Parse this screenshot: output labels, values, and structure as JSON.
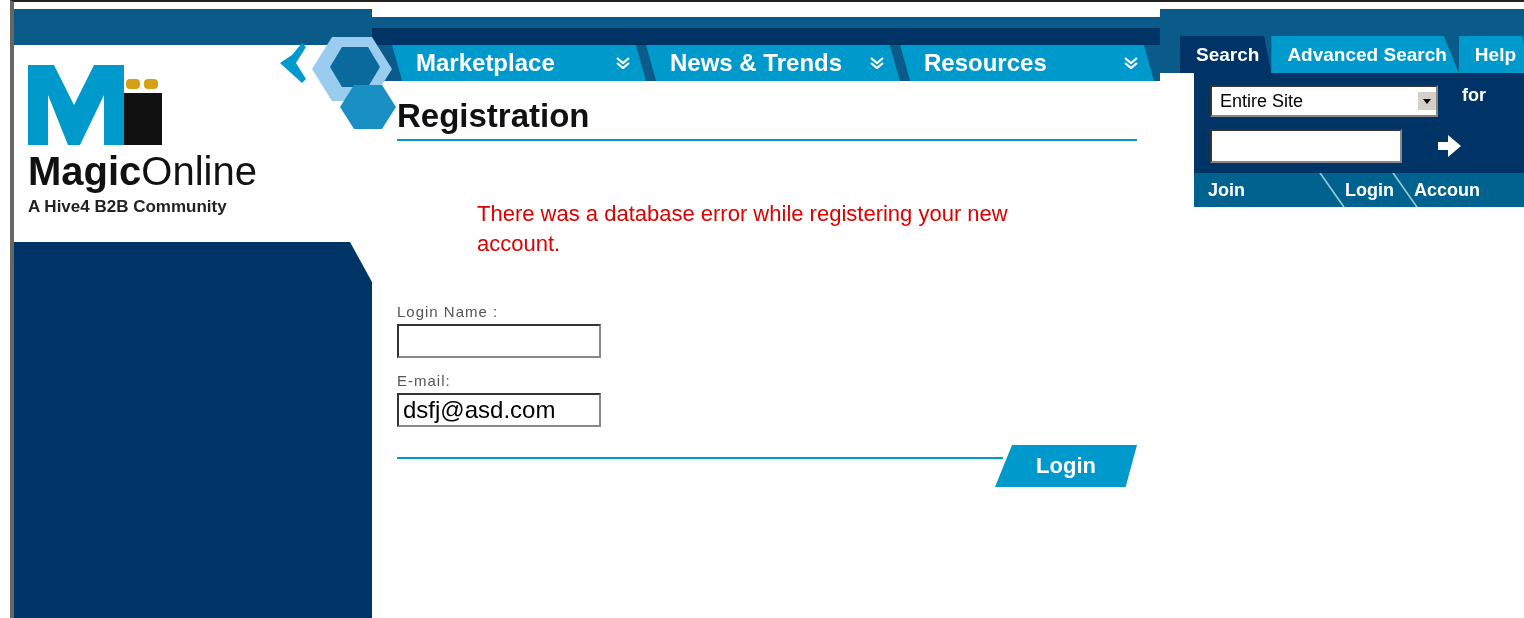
{
  "logo": {
    "name_bold": "Magic",
    "name_rest": "Online",
    "tagline": "A Hive4 B2B Community"
  },
  "nav": [
    {
      "label": "Marketplace"
    },
    {
      "label": "News & Trends"
    },
    {
      "label": "Resources"
    }
  ],
  "search_tabs": [
    {
      "label": "Search",
      "selected": true
    },
    {
      "label": "Advanced Search",
      "selected": false
    },
    {
      "label": "Help",
      "selected": false
    }
  ],
  "search": {
    "scope": "Entire Site",
    "for_label": "for"
  },
  "account_links": [
    "Join",
    "Login",
    "Accoun"
  ],
  "page_title": "Registration",
  "error": "There was a database error while registering your new account.",
  "fields": [
    {
      "label": "Login Name :"
    },
    {
      "label": "E-mail:",
      "value": "dsfj@asd.com"
    }
  ],
  "submit": "Login"
}
